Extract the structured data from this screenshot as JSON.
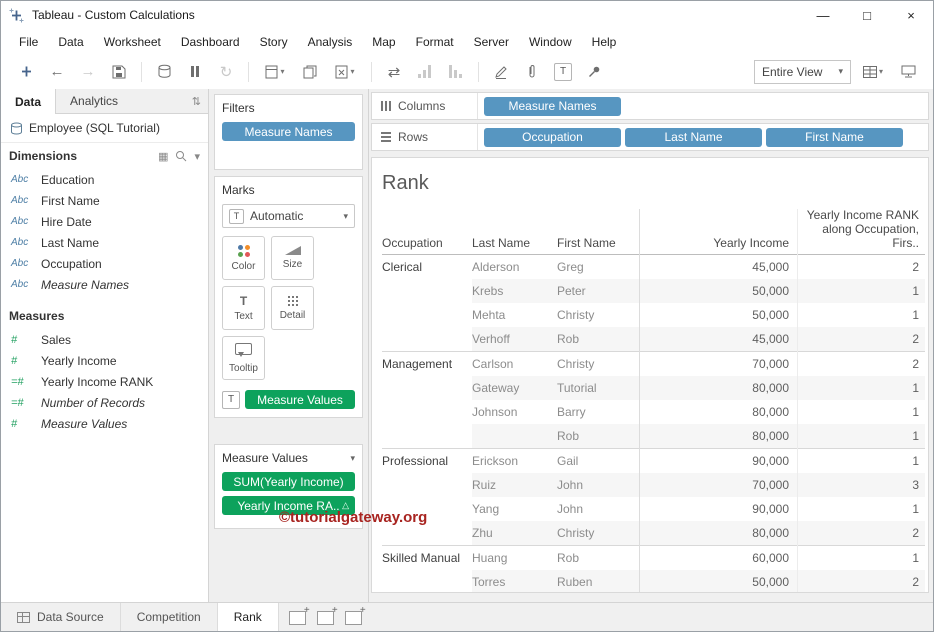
{
  "window": {
    "title": "Tableau - Custom Calculations",
    "controls": {
      "minimize": "—",
      "maximize": "□",
      "close": "×"
    }
  },
  "menu": {
    "items": [
      "File",
      "Data",
      "Worksheet",
      "Dashboard",
      "Story",
      "Analysis",
      "Map",
      "Format",
      "Server",
      "Window",
      "Help"
    ]
  },
  "toolbar": {
    "fit_label": "Entire View"
  },
  "colors": {
    "pill_blue": "#5796c1",
    "pill_green": "#0da25c",
    "watermark": "#a82420",
    "dimension_icon": "#4d7ea5",
    "measure_icon": "#22a060"
  },
  "data_pane": {
    "tabs": [
      {
        "label": "Data"
      },
      {
        "label": "Analytics"
      }
    ],
    "datasource": "Employee (SQL Tutorial)",
    "dimensions": {
      "header": "Dimensions",
      "items": [
        {
          "prefix": "Abc",
          "label": "Education",
          "italic": false
        },
        {
          "prefix": "Abc",
          "label": "First Name",
          "italic": false
        },
        {
          "prefix": "Abc",
          "label": "Hire Date",
          "italic": false
        },
        {
          "prefix": "Abc",
          "label": "Last Name",
          "italic": false
        },
        {
          "prefix": "Abc",
          "label": "Occupation",
          "italic": false
        },
        {
          "prefix": "Abc",
          "label": "Measure Names",
          "italic": true
        }
      ]
    },
    "measures": {
      "header": "Measures",
      "items": [
        {
          "prefix": "#",
          "label": "Sales",
          "italic": false
        },
        {
          "prefix": "#",
          "label": "Yearly Income",
          "italic": false
        },
        {
          "prefix": "=#",
          "label": "Yearly Income RANK",
          "italic": false
        },
        {
          "prefix": "=#",
          "label": "Number of Records",
          "italic": true
        },
        {
          "prefix": "#",
          "label": "Measure Values",
          "italic": true
        }
      ]
    }
  },
  "filters": {
    "title": "Filters",
    "pill": "Measure Names"
  },
  "marks": {
    "title": "Marks",
    "mark_type": "Automatic",
    "buttons": [
      {
        "label": "Color"
      },
      {
        "label": "Size"
      },
      {
        "label": "Text"
      },
      {
        "label": "Detail"
      },
      {
        "label": "Tooltip"
      }
    ],
    "pill": "Measure Values"
  },
  "measure_values_card": {
    "title": "Measure Values",
    "pills": [
      {
        "label": "SUM(Yearly Income)",
        "indicator": ""
      },
      {
        "label": "Yearly Income RA..",
        "indicator": "△"
      }
    ]
  },
  "shelves": {
    "columns": {
      "label": "Columns",
      "pills": [
        "Measure Names"
      ]
    },
    "rows": {
      "label": "Rows",
      "pills": [
        "Occupation",
        "Last Name",
        "First Name"
      ]
    }
  },
  "sheet": {
    "title": "Rank",
    "table": {
      "headers": {
        "occupation": "Occupation",
        "last_name": "Last Name",
        "first_name": "First Name",
        "yearly_income": "Yearly Income",
        "rank_line1": "Yearly Income RANK",
        "rank_line2": "along Occupation, Firs.."
      },
      "groups": [
        {
          "occupation": "Clerical",
          "rows": [
            [
              "Alderson",
              "Greg",
              "45,000",
              "2"
            ],
            [
              "Krebs",
              "Peter",
              "50,000",
              "1"
            ],
            [
              "Mehta",
              "Christy",
              "50,000",
              "1"
            ],
            [
              "Verhoff",
              "Rob",
              "45,000",
              "2"
            ]
          ]
        },
        {
          "occupation": "Management",
          "rows": [
            [
              "Carlson",
              "Christy",
              "70,000",
              "2"
            ],
            [
              "Gateway",
              "Tutorial",
              "80,000",
              "1"
            ],
            [
              "Johnson",
              "Barry",
              "80,000",
              "1"
            ],
            [
              "",
              "Rob",
              "80,000",
              "1"
            ]
          ]
        },
        {
          "occupation": "Professional",
          "rows": [
            [
              "Erickson",
              "Gail",
              "90,000",
              "1"
            ],
            [
              "Ruiz",
              "John",
              "70,000",
              "3"
            ],
            [
              "Yang",
              "John",
              "90,000",
              "1"
            ],
            [
              "Zhu",
              "Christy",
              "80,000",
              "2"
            ]
          ]
        },
        {
          "occupation": "Skilled Manual",
          "rows": [
            [
              "Huang",
              "Rob",
              "60,000",
              "1"
            ],
            [
              "Torres",
              "Ruben",
              "50,000",
              "2"
            ]
          ]
        }
      ]
    }
  },
  "watermark": {
    "text": "©tutorialgateway.org"
  },
  "bottom_bar": {
    "tabs": [
      {
        "label": "Data Source",
        "active": false
      },
      {
        "label": "Competition",
        "active": false
      },
      {
        "label": "Rank",
        "active": true
      }
    ]
  }
}
